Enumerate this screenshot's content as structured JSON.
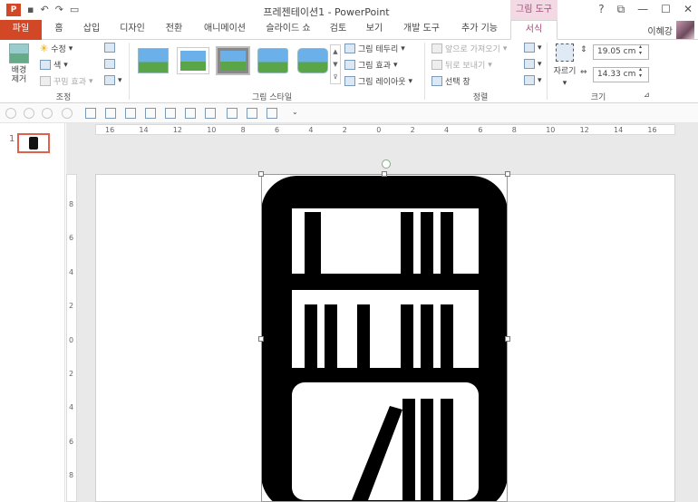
{
  "titlebar": {
    "app_icon_letter": "P",
    "doc_title": "프레젠테이션1 - PowerPoint",
    "contextual_title": "그림 도구",
    "window_controls": [
      "?",
      "⧉",
      "—",
      "☐",
      "✕"
    ]
  },
  "tabs": [
    "파일",
    "홈",
    "삽입",
    "디자인",
    "전환",
    "애니메이션",
    "슬라이드 쇼",
    "검토",
    "보기",
    "개발 도구",
    "추가 기능",
    "서식"
  ],
  "user": {
    "name": "이혜강"
  },
  "ribbon": {
    "adjust": {
      "label": "조정",
      "remove_bg": "배경\n제거",
      "corrections": "수정",
      "color": "색",
      "artistic": "꾸밈 효과"
    },
    "styles": {
      "label": "그림 스타일",
      "border": "그림 테두리",
      "effects": "그림 효과",
      "layout": "그림 레이아웃"
    },
    "arrange": {
      "label": "정렬",
      "bring_forward": "앞으로 가져오기",
      "send_backward": "뒤로 보내기",
      "selection_pane": "선택 창"
    },
    "size": {
      "label": "크기",
      "crop": "자르기",
      "height": "19.05 cm",
      "width": "14.33 cm"
    }
  },
  "ruler": {
    "h_ticks": [
      "16",
      "14",
      "12",
      "10",
      "8",
      "6",
      "4",
      "2",
      "0",
      "2",
      "4",
      "6",
      "8",
      "10",
      "12",
      "14",
      "16"
    ],
    "v_ticks": [
      "8",
      "6",
      "4",
      "2",
      "0",
      "2",
      "4",
      "6",
      "8"
    ]
  },
  "slides_pane": {
    "slide_number": "1"
  },
  "colors": {
    "accent": "#d24726",
    "context": "#a64b79"
  }
}
